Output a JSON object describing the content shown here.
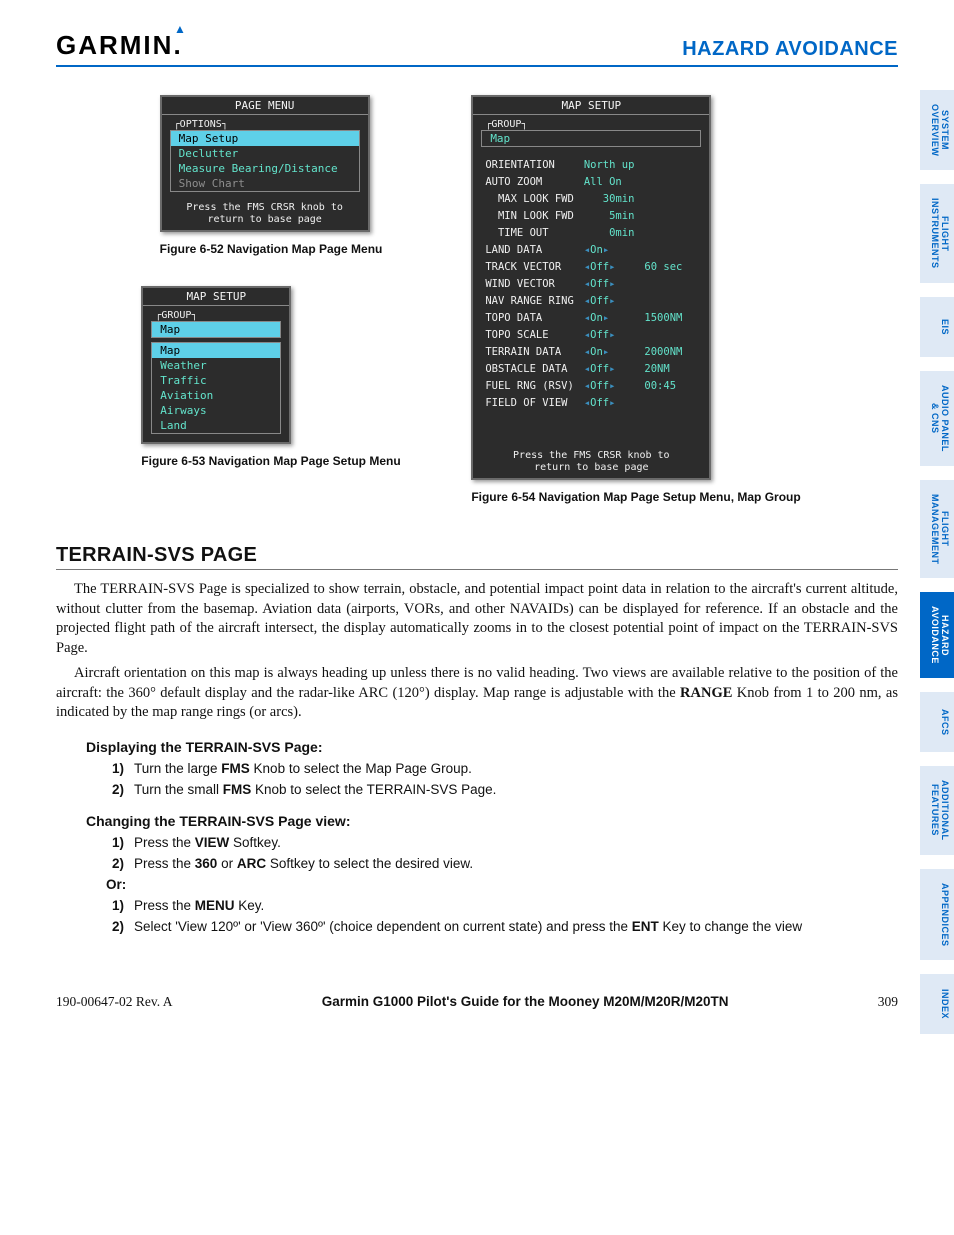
{
  "header": {
    "brand": "GARMIN",
    "section": "HAZARD AVOIDANCE"
  },
  "tabs": [
    {
      "line1": "SYSTEM",
      "line2": "OVERVIEW",
      "active": false
    },
    {
      "line1": "FLIGHT",
      "line2": "INSTRUMENTS",
      "active": false
    },
    {
      "line1": "EIS",
      "line2": "",
      "active": false
    },
    {
      "line1": "AUDIO PANEL",
      "line2": "& CNS",
      "active": false
    },
    {
      "line1": "FLIGHT",
      "line2": "MANAGEMENT",
      "active": false
    },
    {
      "line1": "HAZARD",
      "line2": "AVOIDANCE",
      "active": true
    },
    {
      "line1": "AFCS",
      "line2": "",
      "active": false
    },
    {
      "line1": "ADDITIONAL",
      "line2": "FEATURES",
      "active": false
    },
    {
      "line1": "APPENDICES",
      "line2": "",
      "active": false
    },
    {
      "line1": "INDEX",
      "line2": "",
      "active": false
    }
  ],
  "fig52": {
    "title": "PAGE MENU",
    "group": "OPTIONS",
    "items": [
      {
        "t": "Map Setup",
        "sel": true
      },
      {
        "t": "Declutter",
        "sel": false
      },
      {
        "t": "Measure Bearing/Distance",
        "sel": false
      },
      {
        "t": "Show Chart",
        "sel": false,
        "dim": true
      }
    ],
    "foot": "Press the FMS CRSR knob to\nreturn to base page",
    "caption": "Figure 6-52  Navigation Map Page Menu"
  },
  "fig53": {
    "title": "MAP SETUP",
    "group": "GROUP",
    "sel": "Map",
    "dropdown": [
      "Map",
      "Weather",
      "Traffic",
      "Aviation",
      "Airways",
      "Land"
    ],
    "caption": "Figure 6-53  Navigation Map Page Setup Menu"
  },
  "fig54": {
    "title": "MAP SETUP",
    "group": "GROUP",
    "sel": "Map",
    "rows": [
      {
        "l": "ORIENTATION",
        "v": "North up"
      },
      {
        "l": "AUTO ZOOM",
        "v": "All On"
      },
      {
        "l": "  MAX LOOK FWD",
        "v": "30min",
        "r": true
      },
      {
        "l": "  MIN LOOK FWD",
        "v": "5min",
        "r": true
      },
      {
        "l": "  TIME OUT",
        "v": "0min",
        "r": true
      },
      {
        "l": "LAND DATA",
        "v": "On",
        "a": true
      },
      {
        "l": "TRACK VECTOR",
        "v": "Off",
        "a": true,
        "ext": "60 sec"
      },
      {
        "l": "WIND VECTOR",
        "v": "Off",
        "a": true
      },
      {
        "l": "NAV RANGE RING",
        "v": "Off",
        "a": true
      },
      {
        "l": "TOPO DATA",
        "v": "On",
        "a": true,
        "ext": "1500NM"
      },
      {
        "l": "TOPO SCALE",
        "v": "Off",
        "a": true
      },
      {
        "l": "TERRAIN DATA",
        "v": "On",
        "a": true,
        "ext": "2000NM"
      },
      {
        "l": "OBSTACLE DATA",
        "v": "Off",
        "a": true,
        "ext": "20NM"
      },
      {
        "l": "FUEL RNG (RSV)",
        "v": "Off",
        "a": true,
        "ext": "00:45"
      },
      {
        "l": "FIELD OF VIEW",
        "v": "Off",
        "a": true
      }
    ],
    "foot": "Press the FMS CRSR knob to\nreturn to base page",
    "caption": "Figure 6-54  Navigation Map Page Setup Menu, Map Group"
  },
  "section_heading": "TERRAIN-SVS PAGE",
  "para1": "The TERRAIN-SVS Page is specialized to show terrain, obstacle, and potential impact point data in relation to the aircraft's current altitude, without clutter from the basemap.  Aviation data (airports, VORs, and other NAVAIDs) can be displayed for reference.  If an obstacle and the projected flight path of the aircraft intersect, the display automatically zooms in to the closest potential point of impact on the TERRAIN-SVS Page.",
  "para2_a": "Aircraft orientation on this map is always heading up unless there is no valid heading.  Two views are available relative to the position of the aircraft: the 360° default display and the radar-like ARC (120°) display.  Map range is adjustable with the ",
  "para2_bold": "RANGE",
  "para2_b": " Knob from 1 to 200 nm, as indicated by the map range rings (or arcs).",
  "proc1_h": "Displaying the TERRAIN-SVS Page:",
  "proc1": [
    {
      "n": "1)",
      "pre": "Turn the large ",
      "b": "FMS",
      "post": " Knob to select the Map Page Group."
    },
    {
      "n": "2)",
      "pre": "Turn the small ",
      "b": "FMS",
      "post": " Knob to select the TERRAIN-SVS Page."
    }
  ],
  "proc2_h": "Changing the TERRAIN-SVS Page view:",
  "proc2": [
    {
      "n": "1)",
      "pre": "Press the ",
      "b": "VIEW",
      "post": " Softkey."
    },
    {
      "n": "2)",
      "pre": "Press the ",
      "b": "360",
      "post_mid": " or ",
      "b2": "ARC",
      "post": " Softkey to select the desired view."
    }
  ],
  "or_label": "Or:",
  "proc3": [
    {
      "n": "1)",
      "pre": "Press the ",
      "b": "MENU",
      "post": " Key."
    },
    {
      "n": "2)",
      "pre": "Select 'View 120º' or 'View 360º' (choice dependent on current state) and press the ",
      "b": "ENT",
      "post": " Key to change the view"
    }
  ],
  "footer": {
    "left": "190-00647-02  Rev. A",
    "mid": "Garmin G1000 Pilot's Guide for the Mooney M20M/M20R/M20TN",
    "right": "309"
  }
}
